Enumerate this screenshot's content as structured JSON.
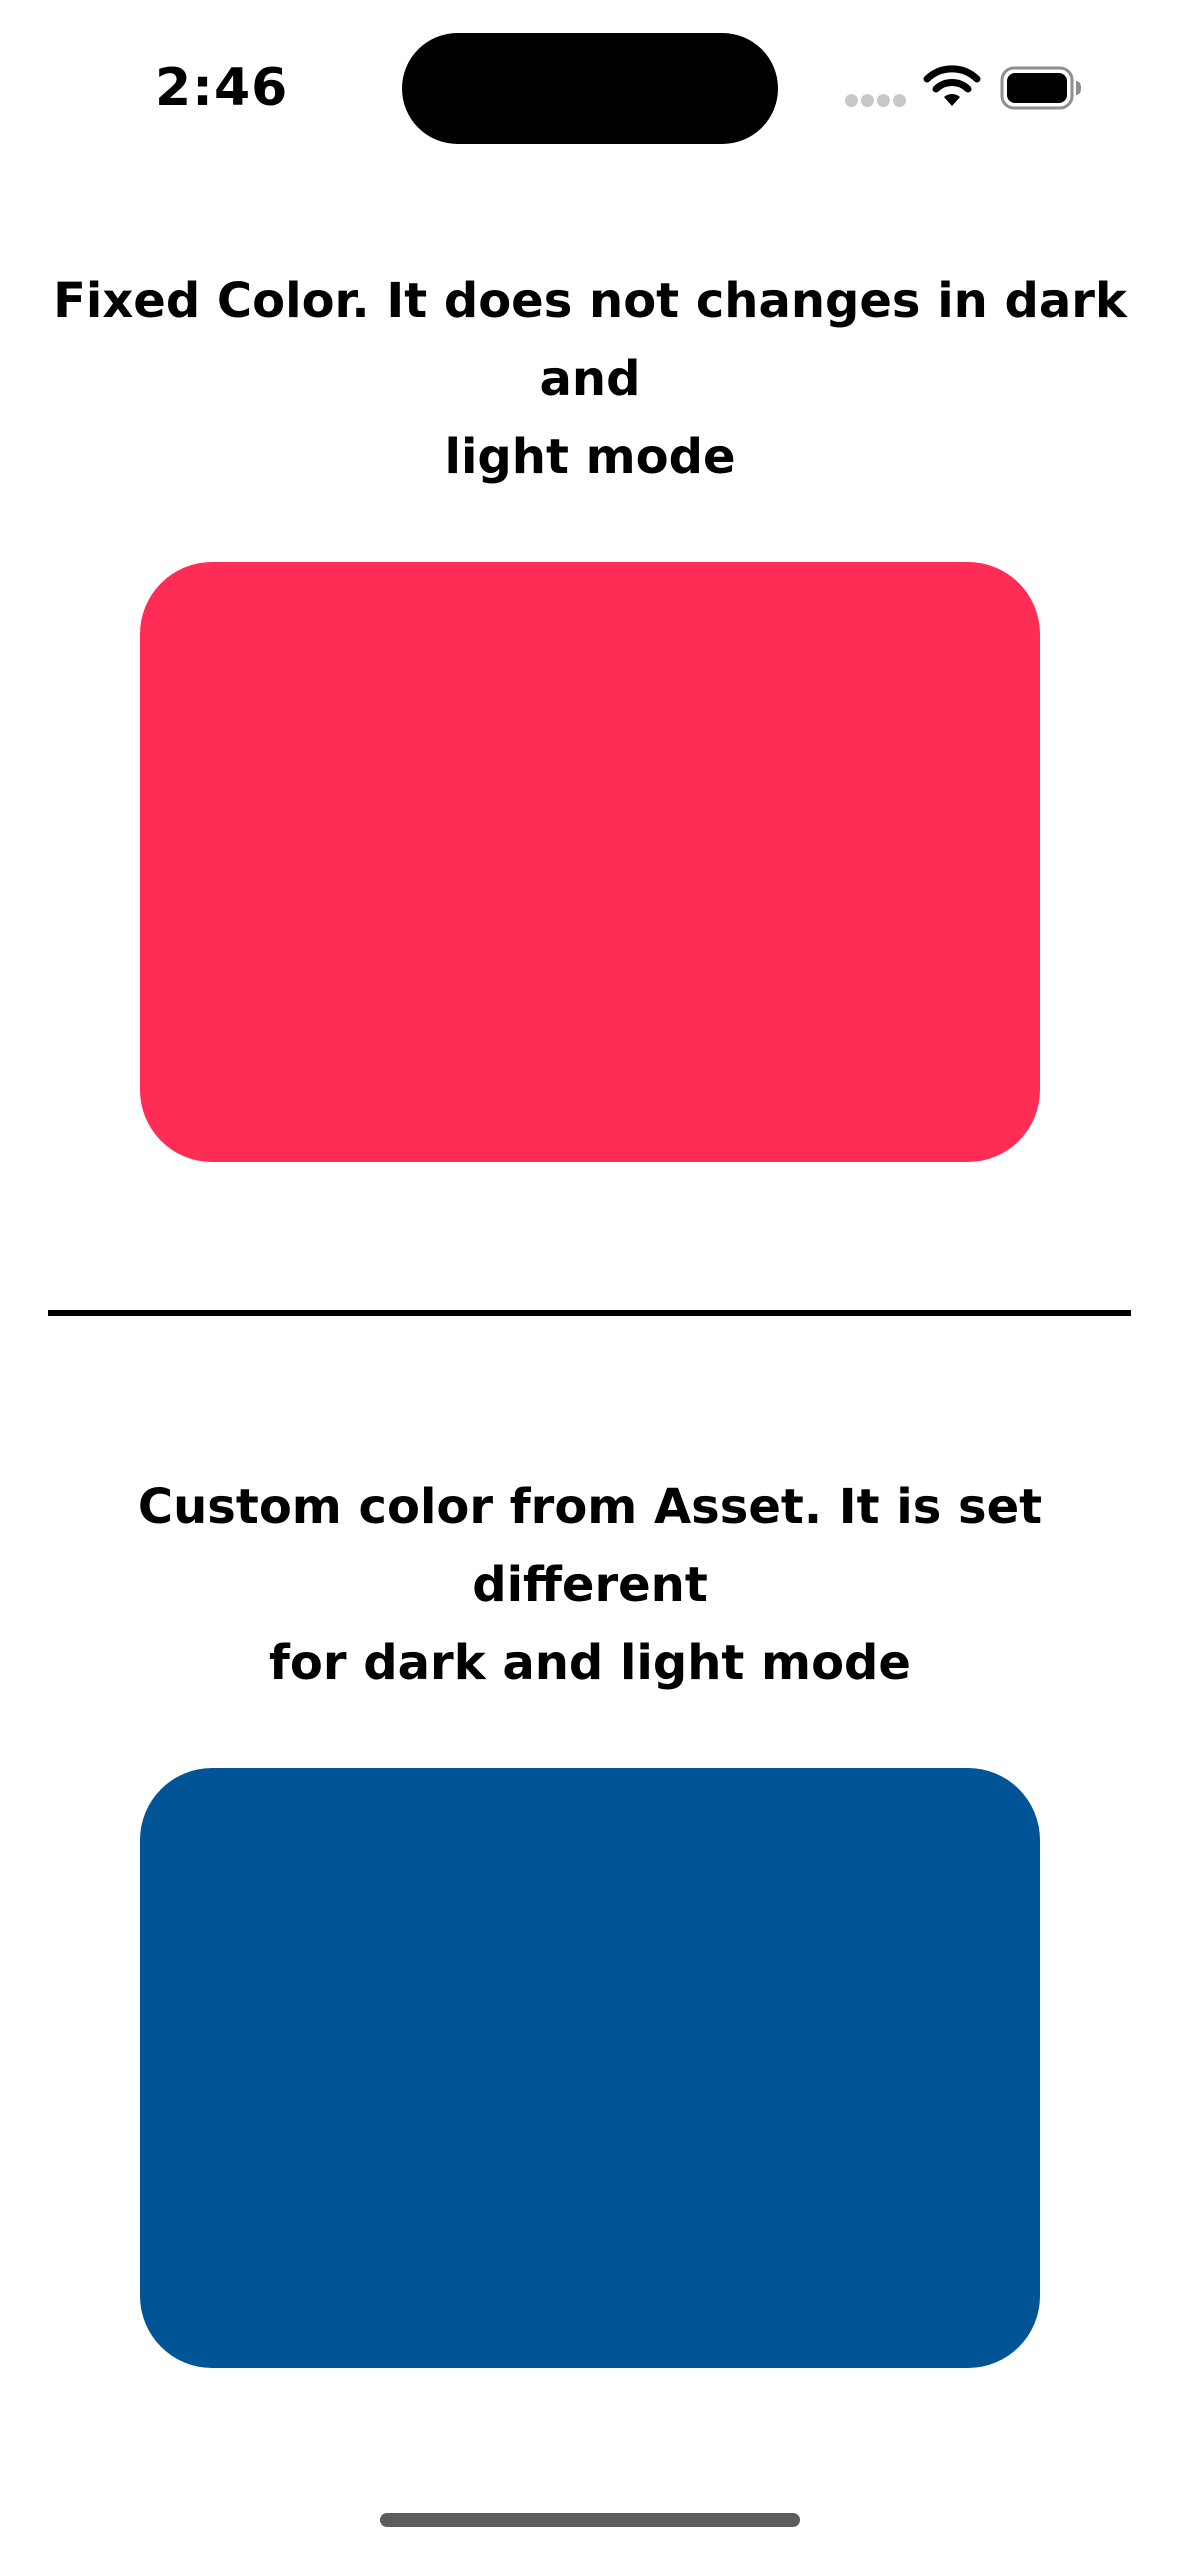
{
  "status_bar": {
    "time": "2:46",
    "icons": [
      "signal-dots-icon",
      "wifi-icon",
      "battery-icon"
    ]
  },
  "sections": [
    {
      "title": "Fixed Color. It does not changes in dark and\nlight mode",
      "color": "#FF2D55"
    },
    {
      "title": "Custom color from Asset. It is set different\nfor dark and light mode",
      "color": "#015596"
    }
  ],
  "colors": {
    "background": "#FFFFFF",
    "text": "#000000",
    "divider": "#000000",
    "home_indicator": "#5C5C5C"
  }
}
